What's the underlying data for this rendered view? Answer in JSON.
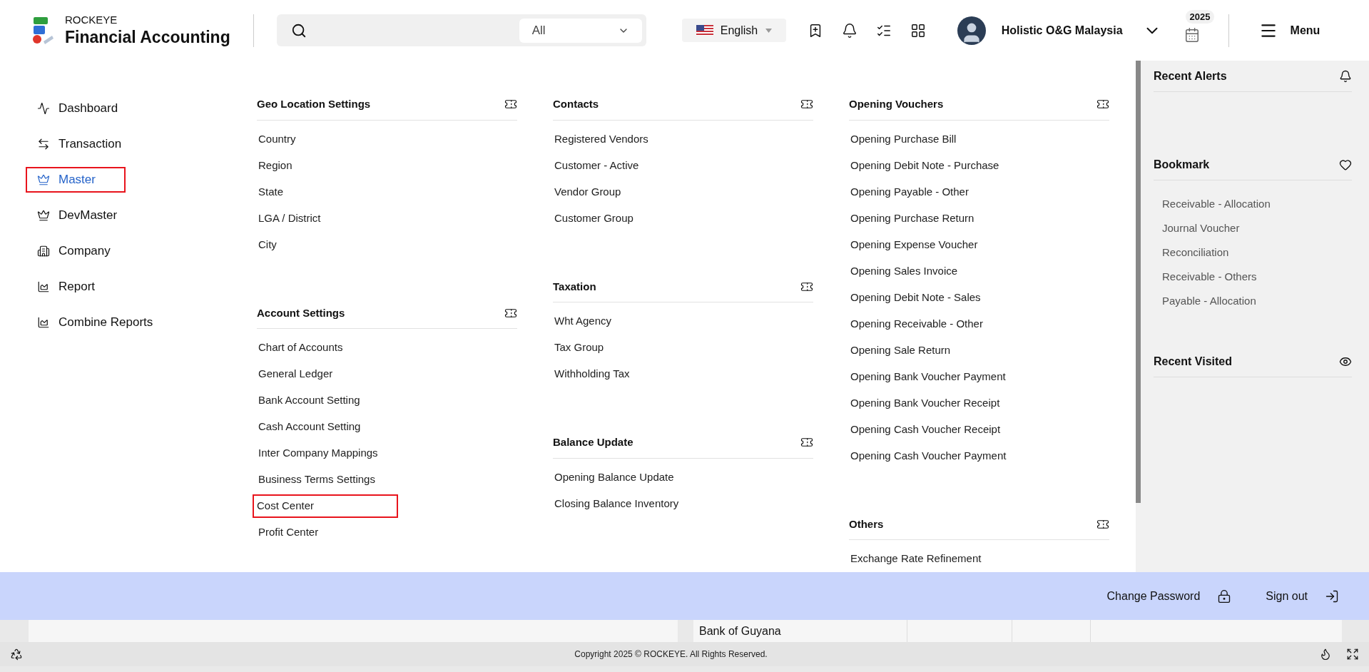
{
  "header": {
    "brand": {
      "company": "ROCKEYE",
      "product": "Financial Accounting"
    },
    "search": {
      "filter": "All"
    },
    "language": "English",
    "user": "Holistic O&G Malaysia",
    "year_badge": "2025",
    "menu_label": "Menu"
  },
  "sidebar": {
    "items": [
      {
        "label": "Dashboard",
        "kind": "chart",
        "selected": false,
        "highlighted": false
      },
      {
        "label": "Transaction",
        "kind": "arrows",
        "selected": false,
        "highlighted": false
      },
      {
        "label": "Master",
        "kind": "crown",
        "selected": true,
        "highlighted": true
      },
      {
        "label": "DevMaster",
        "kind": "crown",
        "selected": false,
        "highlighted": false
      },
      {
        "label": "Company",
        "kind": "building",
        "selected": false,
        "highlighted": false
      },
      {
        "label": "Report",
        "kind": "report",
        "selected": false,
        "highlighted": false
      },
      {
        "label": "Combine Reports",
        "kind": "report",
        "selected": false,
        "highlighted": false
      }
    ]
  },
  "mega_menu": {
    "columns": [
      {
        "sections": [
          {
            "title": "Geo Location Settings",
            "items": [
              {
                "label": "Country",
                "highlighted": false
              },
              {
                "label": "Region",
                "highlighted": false
              },
              {
                "label": "State",
                "highlighted": false
              },
              {
                "label": "LGA / District",
                "highlighted": false
              },
              {
                "label": "City",
                "highlighted": false
              }
            ]
          },
          {
            "title": "Account Settings",
            "items": [
              {
                "label": "Chart of Accounts",
                "highlighted": false
              },
              {
                "label": "General Ledger",
                "highlighted": false
              },
              {
                "label": "Bank Account Setting",
                "highlighted": false
              },
              {
                "label": "Cash Account Setting",
                "highlighted": false
              },
              {
                "label": "Inter Company Mappings",
                "highlighted": false
              },
              {
                "label": "Business Terms Settings",
                "highlighted": false
              },
              {
                "label": "Cost Center",
                "highlighted": true
              },
              {
                "label": "Profit Center",
                "highlighted": false
              }
            ]
          }
        ]
      },
      {
        "sections": [
          {
            "title": "Contacts",
            "items": [
              {
                "label": "Registered Vendors",
                "highlighted": false
              },
              {
                "label": "Customer - Active",
                "highlighted": false
              },
              {
                "label": "Vendor Group",
                "highlighted": false
              },
              {
                "label": "Customer Group",
                "highlighted": false
              }
            ]
          },
          {
            "title": "Taxation",
            "items": [
              {
                "label": "Wht Agency",
                "highlighted": false
              },
              {
                "label": "Tax Group",
                "highlighted": false
              },
              {
                "label": "Withholding Tax",
                "highlighted": false
              }
            ]
          },
          {
            "title": "Balance Update",
            "items": [
              {
                "label": "Opening Balance Update",
                "highlighted": false
              },
              {
                "label": "Closing Balance Inventory",
                "highlighted": false
              }
            ]
          }
        ]
      },
      {
        "sections": [
          {
            "title": "Opening Vouchers",
            "items": [
              {
                "label": "Opening Purchase Bill",
                "highlighted": false
              },
              {
                "label": "Opening Debit Note - Purchase",
                "highlighted": false
              },
              {
                "label": "Opening Payable - Other",
                "highlighted": false
              },
              {
                "label": "Opening Purchase Return",
                "highlighted": false
              },
              {
                "label": "Opening Expense Voucher",
                "highlighted": false
              },
              {
                "label": "Opening Sales Invoice",
                "highlighted": false
              },
              {
                "label": "Opening Debit Note - Sales",
                "highlighted": false
              },
              {
                "label": "Opening Receivable - Other",
                "highlighted": false
              },
              {
                "label": "Opening Sale Return",
                "highlighted": false
              },
              {
                "label": "Opening Bank Voucher Payment",
                "highlighted": false
              },
              {
                "label": "Opening Bank Voucher Receipt",
                "highlighted": false
              },
              {
                "label": "Opening Cash Voucher Receipt",
                "highlighted": false
              },
              {
                "label": "Opening Cash Voucher Payment",
                "highlighted": false
              }
            ]
          },
          {
            "title": "Others",
            "items": [
              {
                "label": "Exchange Rate Refinement",
                "highlighted": false
              }
            ]
          }
        ]
      }
    ]
  },
  "right_panel": {
    "sections": [
      {
        "title": "Recent Alerts",
        "kind": "bell"
      },
      {
        "title": "Bookmark",
        "kind": "heart",
        "items": [
          "Receivable - Allocation",
          "Journal Voucher",
          "Reconciliation",
          "Receivable - Others",
          "Payable - Allocation"
        ]
      },
      {
        "title": "Recent Visited",
        "kind": "eye"
      }
    ]
  },
  "account_bar": {
    "actions": [
      {
        "label": "Change Password",
        "kind": "lock"
      },
      {
        "label": "Sign out",
        "kind": "signout"
      }
    ]
  },
  "background_table": {
    "cell": "Bank of Guyana"
  },
  "status_bar": {
    "copyright": "Copyright 2025 © ROCKEYE. All Rights Reserved."
  }
}
